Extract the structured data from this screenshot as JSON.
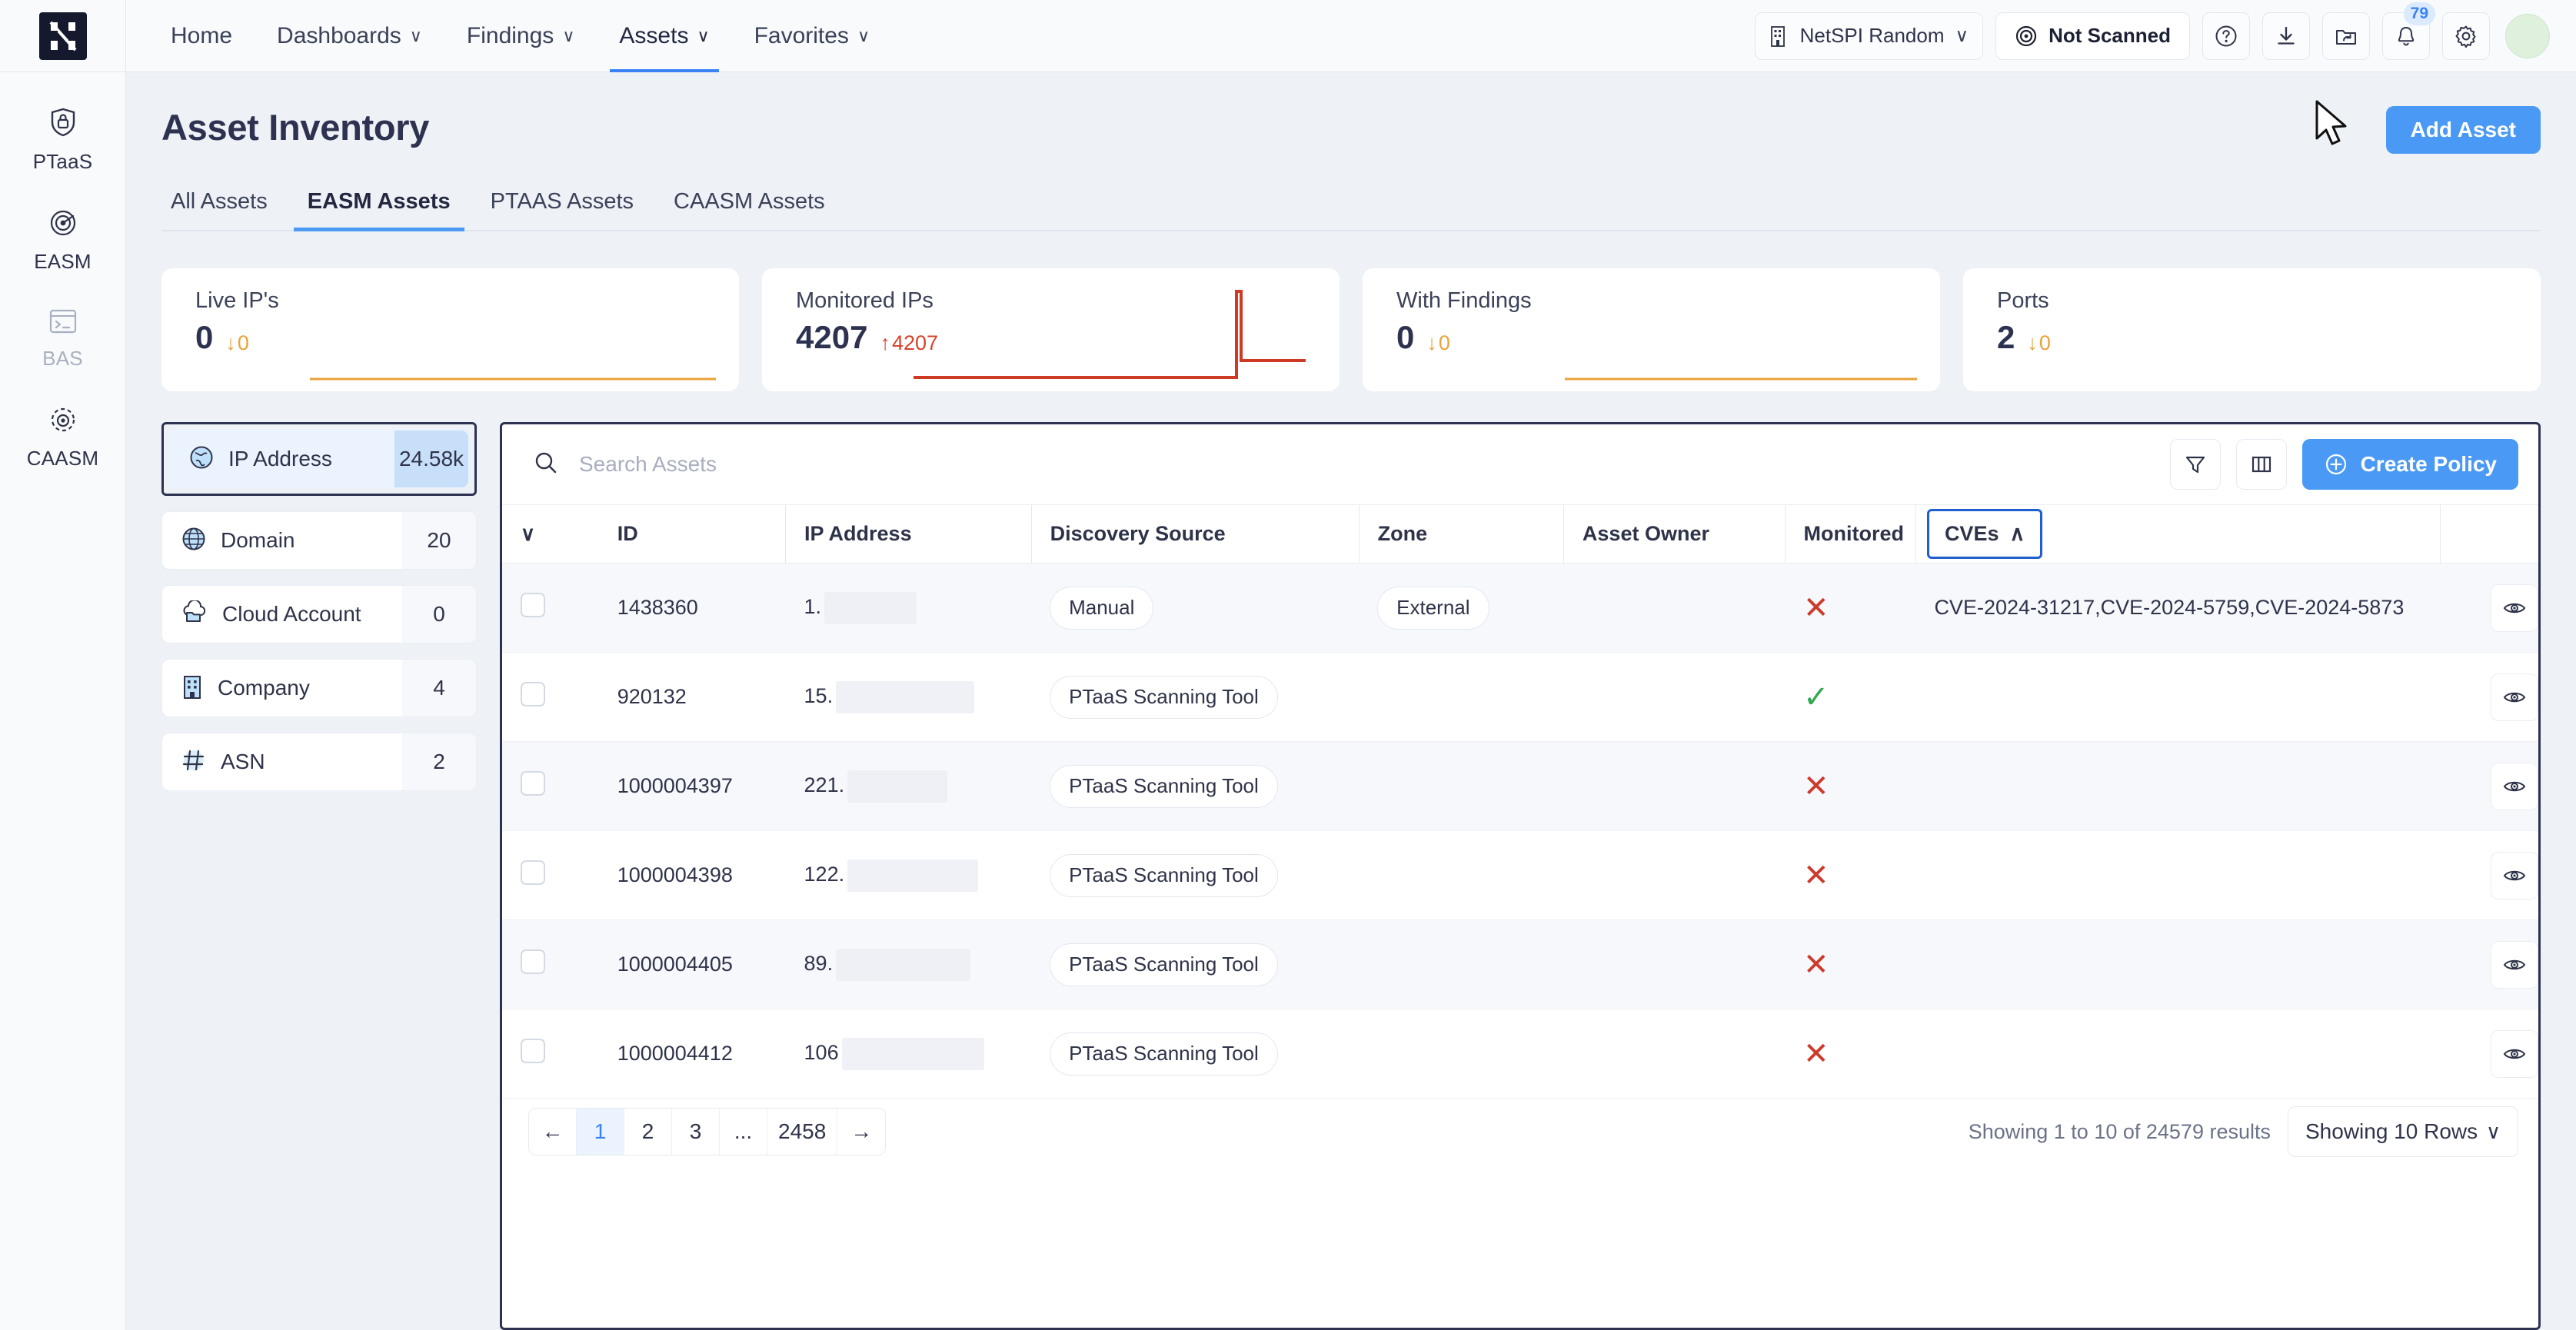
{
  "topbar": {
    "logo_name": "netspi-logo",
    "nav": [
      {
        "label": "Home",
        "caret": ""
      },
      {
        "label": "Dashboards",
        "caret": "∨"
      },
      {
        "label": "Findings",
        "caret": "∨"
      },
      {
        "label": "Assets",
        "caret": "∨"
      },
      {
        "label": "Favorites",
        "caret": "∨"
      }
    ],
    "org": {
      "label": "NetSPI Random",
      "caret": "∨"
    },
    "scan_status": "Not Scanned",
    "notifications_badge": "79"
  },
  "sidebar": {
    "items": [
      {
        "label": "PTaaS",
        "icon": "shield-lock-icon",
        "disabled": false
      },
      {
        "label": "EASM",
        "icon": "radar-icon",
        "disabled": false
      },
      {
        "label": "BAS",
        "icon": "terminal-icon",
        "disabled": true
      },
      {
        "label": "CAASM",
        "icon": "orbit-icon",
        "disabled": false
      }
    ]
  },
  "page": {
    "title": "Asset Inventory",
    "add_asset_label": "Add Asset",
    "tabs": [
      {
        "label": "All Assets",
        "active": false
      },
      {
        "label": "EASM Assets",
        "active": true
      },
      {
        "label": "PTAAS Assets",
        "active": false
      },
      {
        "label": "CAASM Assets",
        "active": false
      }
    ]
  },
  "cards": [
    {
      "title": "Live IP's",
      "value": "0",
      "delta": "0",
      "direction": "down",
      "color": "#eba238",
      "spark": "flat"
    },
    {
      "title": "Monitored IPs",
      "value": "4207",
      "delta": "4207",
      "direction": "up",
      "color": "#d8422a",
      "spark": "spike"
    },
    {
      "title": "With Findings",
      "value": "0",
      "delta": "0",
      "direction": "down",
      "color": "#eba238",
      "spark": "flat"
    },
    {
      "title": "Ports",
      "value": "2",
      "delta": "0",
      "direction": "down",
      "color": "#eba238",
      "spark": "none"
    }
  ],
  "facets": [
    {
      "label": "IP Address",
      "count": "24.58k",
      "icon": "globe-americas-icon",
      "selected": true
    },
    {
      "label": "Domain",
      "count": "20",
      "icon": "globe-grid-icon",
      "selected": false
    },
    {
      "label": "Cloud Account",
      "count": "0",
      "icon": "cloud-folder-icon",
      "selected": false
    },
    {
      "label": "Company",
      "count": "4",
      "icon": "building-icon",
      "selected": false
    },
    {
      "label": "ASN",
      "count": "2",
      "icon": "hash-icon",
      "selected": false
    }
  ],
  "toolbar": {
    "search_placeholder": "Search Assets",
    "search_value": "",
    "create_policy_label": "Create Policy"
  },
  "table": {
    "columns": [
      "ID",
      "IP Address",
      "Discovery Source",
      "Zone",
      "Asset Owner",
      "Monitored",
      "CVEs"
    ],
    "sorted_column": "CVEs",
    "sort_direction": "asc",
    "rows": [
      {
        "id": "1438360",
        "ip_prefix": "1.",
        "redact_width": 120,
        "source": "Manual",
        "zone": "External",
        "owner": "",
        "monitored": "no",
        "cves": "CVE-2024-31217,CVE-2024-5759,CVE-2024-5873"
      },
      {
        "id": "920132",
        "ip_prefix": "15.",
        "redact_width": 180,
        "source": "PTaaS Scanning Tool",
        "zone": "",
        "owner": "",
        "monitored": "yes",
        "cves": ""
      },
      {
        "id": "1000004397",
        "ip_prefix": "221.",
        "redact_width": 130,
        "source": "PTaaS Scanning Tool",
        "zone": "",
        "owner": "",
        "monitored": "no",
        "cves": ""
      },
      {
        "id": "1000004398",
        "ip_prefix": "122.",
        "redact_width": 170,
        "source": "PTaaS Scanning Tool",
        "zone": "",
        "owner": "",
        "monitored": "no",
        "cves": ""
      },
      {
        "id": "1000004405",
        "ip_prefix": "89.",
        "redact_width": 175,
        "source": "PTaaS Scanning Tool",
        "zone": "",
        "owner": "",
        "monitored": "no",
        "cves": ""
      },
      {
        "id": "1000004412",
        "ip_prefix": "106",
        "redact_width": 185,
        "source": "PTaaS Scanning Tool",
        "zone": "",
        "owner": "",
        "monitored": "no",
        "cves": ""
      }
    ]
  },
  "pagination": {
    "prev": "←",
    "pages": [
      "1",
      "2",
      "3",
      "...",
      "2458"
    ],
    "current": "1",
    "next": "→",
    "results_text": "Showing 1 to 10 of 24579 results",
    "rows_per_page": "Showing 10 Rows",
    "rows_caret": "∨"
  },
  "colors": {
    "accent": "#4a9af5",
    "dark": "#2d3250",
    "warn": "#eba238",
    "danger": "#cd3a2c",
    "success": "#2fa84f"
  }
}
